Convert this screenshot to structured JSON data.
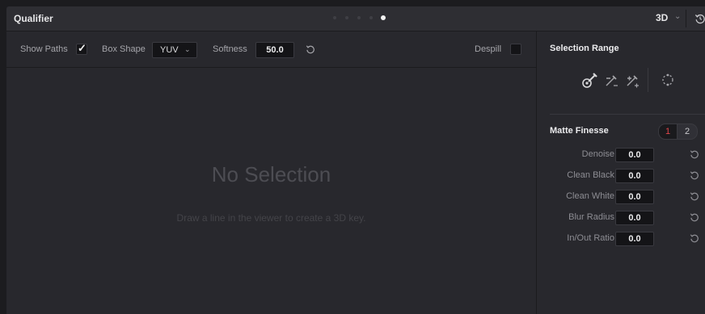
{
  "header": {
    "title": "Qualifier",
    "mode": "3D"
  },
  "controls": {
    "show_paths_label": "Show Paths",
    "show_paths_checked": true,
    "box_shape_label": "Box Shape",
    "box_shape_value": "YUV",
    "softness_label": "Softness",
    "softness_value": "50.0",
    "despill_label": "Despill",
    "despill_checked": false
  },
  "viewer": {
    "empty_title": "No Selection",
    "empty_hint": "Draw a line in the viewer to create a 3D key."
  },
  "selection_range": {
    "title": "Selection Range",
    "tools": [
      "picker-icon",
      "picker-minus-icon",
      "picker-plus-icon",
      "feather-icon"
    ]
  },
  "matte_finesse": {
    "title": "Matte Finesse",
    "toggle_options": [
      "1",
      "2"
    ],
    "active_toggle": "1",
    "params": [
      {
        "label": "Denoise",
        "value": "0.0"
      },
      {
        "label": "Clean Black",
        "value": "0.0"
      },
      {
        "label": "Clean White",
        "value": "0.0"
      },
      {
        "label": "Blur Radius",
        "value": "0.0"
      },
      {
        "label": "In/Out Ratio",
        "value": "0.0"
      }
    ]
  },
  "colors": {
    "panel_bg": "#28282d",
    "field_bg": "#141417",
    "accent_red": "#e0464a"
  }
}
